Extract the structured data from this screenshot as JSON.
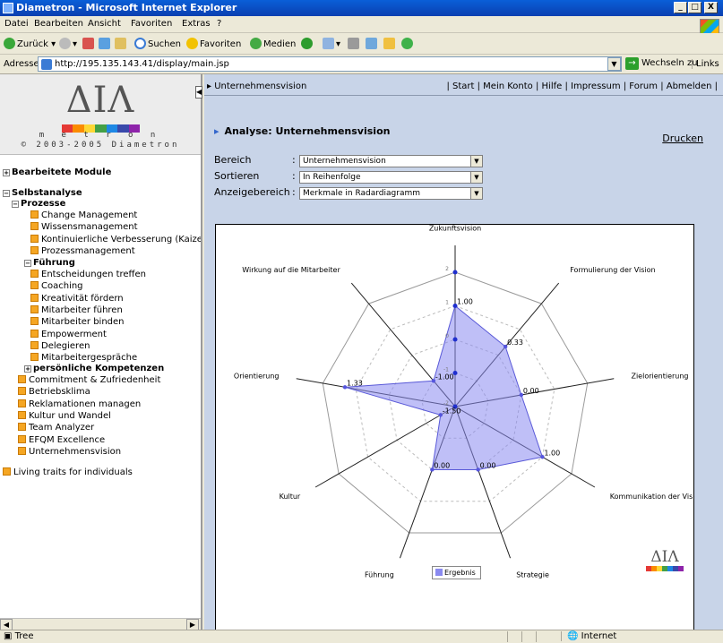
{
  "window": {
    "title": "Diametron - Microsoft Internet Explorer",
    "controls": [
      "_",
      "□",
      "X"
    ]
  },
  "menu": [
    "Datei",
    "Bearbeiten",
    "Ansicht",
    "Favoriten",
    "Extras",
    "?"
  ],
  "toolbar": {
    "back": "Zurück",
    "search": "Suchen",
    "favorites": "Favoriten",
    "media": "Medien"
  },
  "address": {
    "label": "Adresse",
    "url": "http://195.135.143.41/display/main.jsp",
    "go": "Wechseln zu",
    "links": "Links"
  },
  "sidebar": {
    "logo_greek": "ΔΙΛ",
    "logo_word": "m e t r o n",
    "logo_colors": [
      "#e53935",
      "#fb8c00",
      "#fdd835",
      "#43a047",
      "#1e88e5",
      "#3949ab",
      "#8e24aa"
    ],
    "copyright": "© 2003-2005 Diametron",
    "section_edited": "Bearbeitete Module",
    "section_self": "Selbstanalyse",
    "group_process": "Prozesse",
    "process_items": [
      "Change Management",
      "Wissensmanagement",
      "Kontinuierliche Verbesserung (Kaize",
      "Prozessmanagement"
    ],
    "group_leadership": "Führung",
    "leadership_items": [
      "Entscheidungen treffen",
      "Coaching",
      "Kreativität fördern",
      "Mitarbeiter führen",
      "Mitarbeiter binden",
      "Empowerment",
      "Delegieren",
      "Mitarbeitergespräche"
    ],
    "group_personal": "persönliche Kompetenzen",
    "other_items": [
      "Commitment & Zufriedenheit",
      "Betriebsklima",
      "Reklamationen managen",
      "Kultur und Wandel",
      "Team Analyzer",
      "EFQM Excellence",
      "Unternehmensvision"
    ],
    "living": "Living traits for individuals"
  },
  "main": {
    "breadcrumb": "Unternehmensvision",
    "top_links": "| Start | Mein Konto | Hilfe | Impressum | Forum | Abmelden |",
    "heading": "Analyse: Unternehmensvision",
    "print": "Drucken",
    "form": {
      "bereich_label": "Bereich",
      "bereich_value": "Unternehmensvision",
      "sort_label": "Sortieren",
      "sort_value": "In Reihenfolge",
      "area_label": "Anzeigebereich",
      "area_value": "Merkmale in Radardiagramm"
    }
  },
  "chart_data": {
    "type": "radar",
    "categories": [
      "Zukunftsvision",
      "Formulierung der Vision",
      "Zielorientierung",
      "Kommunikation der Vision",
      "Strategie",
      "Führung",
      "Kultur",
      "Orientierung",
      "Wirkung auf die Mitarbeiter"
    ],
    "values": [
      1.0,
      0.33,
      0.0,
      1.0,
      0.0,
      0.0,
      -1.5,
      1.33,
      -1.0
    ],
    "value_labels": [
      "1.00",
      "0.33",
      "0.00",
      "1.00",
      "0.00",
      "0.00",
      "-1.50",
      "1.33",
      "-1.00"
    ],
    "ticks": [
      "2",
      "1",
      "0",
      "-1",
      "-2"
    ],
    "range": [
      -2,
      2
    ],
    "series": [
      {
        "name": "Ergebnis",
        "color": "#8a8af0",
        "values": [
          1.0,
          0.33,
          0.0,
          1.0,
          0.0,
          0.0,
          -1.5,
          1.33,
          -1.0
        ]
      }
    ],
    "legend": "bottom-center"
  },
  "chart_logo": {
    "greek": "ΔΙΛ"
  },
  "status": {
    "left": "Tree",
    "zone": "Internet"
  }
}
